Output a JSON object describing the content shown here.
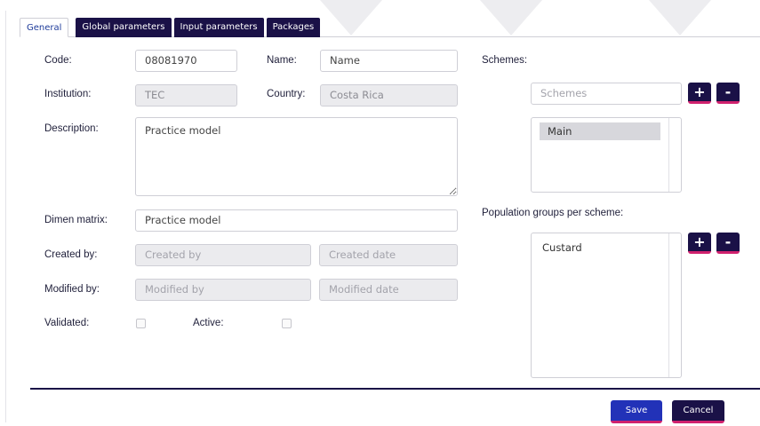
{
  "tabs": [
    {
      "label": "General",
      "active": true
    },
    {
      "label": "Global parameters",
      "active": false
    },
    {
      "label": "Input parameters",
      "active": false
    },
    {
      "label": "Packages",
      "active": false
    }
  ],
  "form": {
    "code_label": "Code:",
    "code_value": "08081970",
    "name_label": "Name:",
    "name_value": "Name",
    "institution_label": "Institution:",
    "institution_value": "TEC",
    "country_label": "Country:",
    "country_value": "Costa Rica",
    "description_label": "Description:",
    "description_value": "Practice model",
    "dimen_label": "Dimen matrix:",
    "dimen_value": "Practice model",
    "created_by_label": "Created by:",
    "created_by_placeholder": "Created by",
    "created_date_placeholder": "Created date",
    "modified_by_label": "Modified by:",
    "modified_by_placeholder": "Modified by",
    "modified_date_placeholder": "Modified date",
    "validated_label": "Validated:",
    "active_label": "Active:"
  },
  "schemes": {
    "label": "Schemes:",
    "input_placeholder": "Schemes",
    "add_label": "+",
    "remove_label": "-",
    "items": [
      "Main"
    ]
  },
  "population": {
    "label": "Population groups per scheme:",
    "add_label": "+",
    "remove_label": "-",
    "items": [
      "Custard"
    ]
  },
  "footer": {
    "save_label": "Save",
    "cancel_label": "Cancel"
  },
  "colors": {
    "navy": "#1a1147",
    "save_blue": "#2232b8",
    "accent_pink": "#d0216e",
    "active_tab_text": "#1e3b9a"
  }
}
